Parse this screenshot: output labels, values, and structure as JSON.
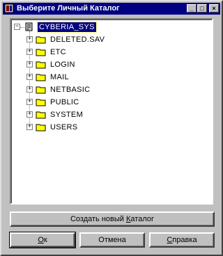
{
  "window": {
    "title": "Выберите Личный Каталог",
    "controls": {
      "min": "_",
      "max": "□",
      "close": "×"
    }
  },
  "tree": {
    "root": {
      "label": "CYBERIA_SYS",
      "expander": "−"
    },
    "items": [
      {
        "label": "DELETED.SAV",
        "expander": "+"
      },
      {
        "label": "ETC",
        "expander": "+"
      },
      {
        "label": "LOGIN",
        "expander": "+"
      },
      {
        "label": "MAIL",
        "expander": "+"
      },
      {
        "label": "NETBASIC",
        "expander": "+"
      },
      {
        "label": "PUBLIC",
        "expander": "+"
      },
      {
        "label": "SYSTEM",
        "expander": "+"
      },
      {
        "label": "USERS",
        "expander": "+"
      }
    ]
  },
  "buttons": {
    "create": {
      "pre": "Создать новый ",
      "acc": "К",
      "post": "аталог"
    },
    "ok": {
      "acc": "О",
      "post": "к"
    },
    "cancel": {
      "label": "Отмена"
    },
    "help": {
      "acc": "С",
      "post": "правка"
    }
  },
  "colors": {
    "titlebar": "#000080",
    "folder": "#ffff00",
    "selection": "#000080",
    "face": "#c0c0c0"
  }
}
